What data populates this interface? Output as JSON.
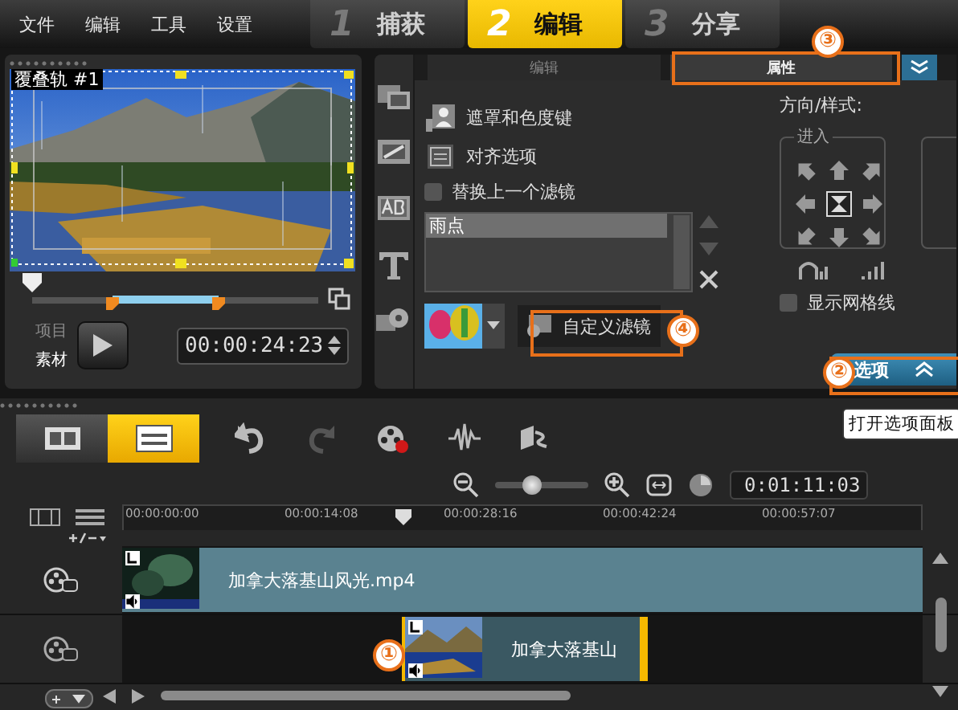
{
  "menu": [
    "文件",
    "编辑",
    "工具",
    "设置"
  ],
  "steps": [
    {
      "number": "1",
      "label": "捕获",
      "selected": false
    },
    {
      "number": "2",
      "label": "编辑",
      "selected": true
    },
    {
      "number": "3",
      "label": "分享",
      "selected": false
    }
  ],
  "preview": {
    "overlay_label": "覆叠轨 #1",
    "scrubber": {
      "level": 0
    },
    "trim_handles": [
      {
        "level": 0.28
      },
      {
        "level": 0.65
      }
    ],
    "modes": [
      {
        "label": "项目",
        "selected": false
      },
      {
        "label": "素材",
        "selected": true
      }
    ],
    "timecode": "00:00:24:23"
  },
  "options_panel": {
    "tabs": [
      {
        "label": "编辑",
        "selected": false
      },
      {
        "label": "属性",
        "selected": true
      }
    ],
    "actions": [
      "遮罩和色度键",
      "对齐选项"
    ],
    "replace_filter": {
      "label": "替换上一个滤镜",
      "checked": false
    },
    "filters": [
      {
        "label": "雨点",
        "selected": true
      }
    ],
    "custom_filter_button": "自定义滤镜",
    "direction_label": "方向/样式:",
    "enter_group": "进入",
    "show_grid": {
      "label": "显示网格线",
      "checked": false
    },
    "options_button": "选项",
    "tooltip": "打开选项面板"
  },
  "annotations": [
    {
      "number": "①",
      "kind": "clip"
    },
    {
      "number": "②",
      "kind": "options"
    },
    {
      "number": "③",
      "kind": "tab"
    },
    {
      "number": "④",
      "kind": "filter"
    }
  ],
  "timeline": {
    "view_buttons": [
      {
        "kind": "storyboard",
        "selected": false
      },
      {
        "kind": "timeline",
        "selected": true
      }
    ],
    "tools": [
      {
        "kind": "undo",
        "disabled": false
      },
      {
        "kind": "redo",
        "disabled": true
      },
      {
        "kind": "record",
        "disabled": false
      },
      {
        "kind": "audio",
        "disabled": false
      },
      {
        "kind": "music",
        "disabled": false
      }
    ],
    "zoom": {
      "level": 0.4
    },
    "timecode": "0:01:11:03",
    "ruler": [
      "00:00:00:00",
      "00:00:14:08",
      "00:00:28:16",
      "00:00:42:24",
      "00:00:57:07"
    ],
    "playhead": {
      "level": 0.35
    },
    "tracks": [
      {
        "clip": "加拿大落基山风光.mp4",
        "selected": false
      },
      {
        "clip": "加拿大落基山",
        "selected": true
      }
    ]
  }
}
